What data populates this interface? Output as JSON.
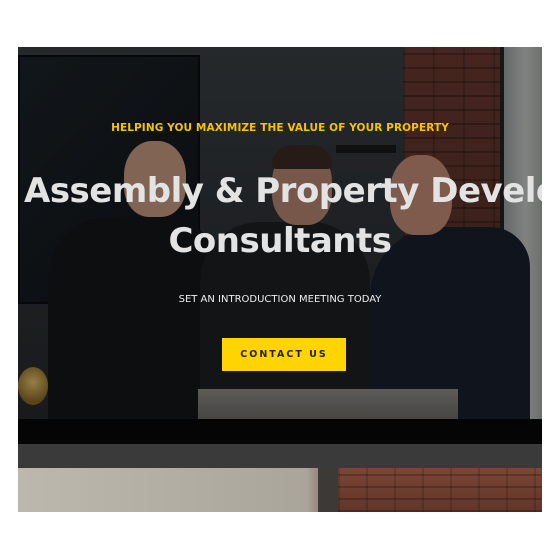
{
  "hero": {
    "eyebrow": "HELPING YOU MAXIMIZE THE VALUE OF YOUR PROPERTY",
    "headline_line1": "Assembly & Property Develop",
    "headline_line2": "Consultants",
    "subline": "SET AN INTRODUCTION MEETING TODAY",
    "cta_label": "CONTACT US"
  },
  "colors": {
    "accent": "#ffd400",
    "eyebrow": "#f5c400",
    "headline": "#e3e3e3"
  }
}
